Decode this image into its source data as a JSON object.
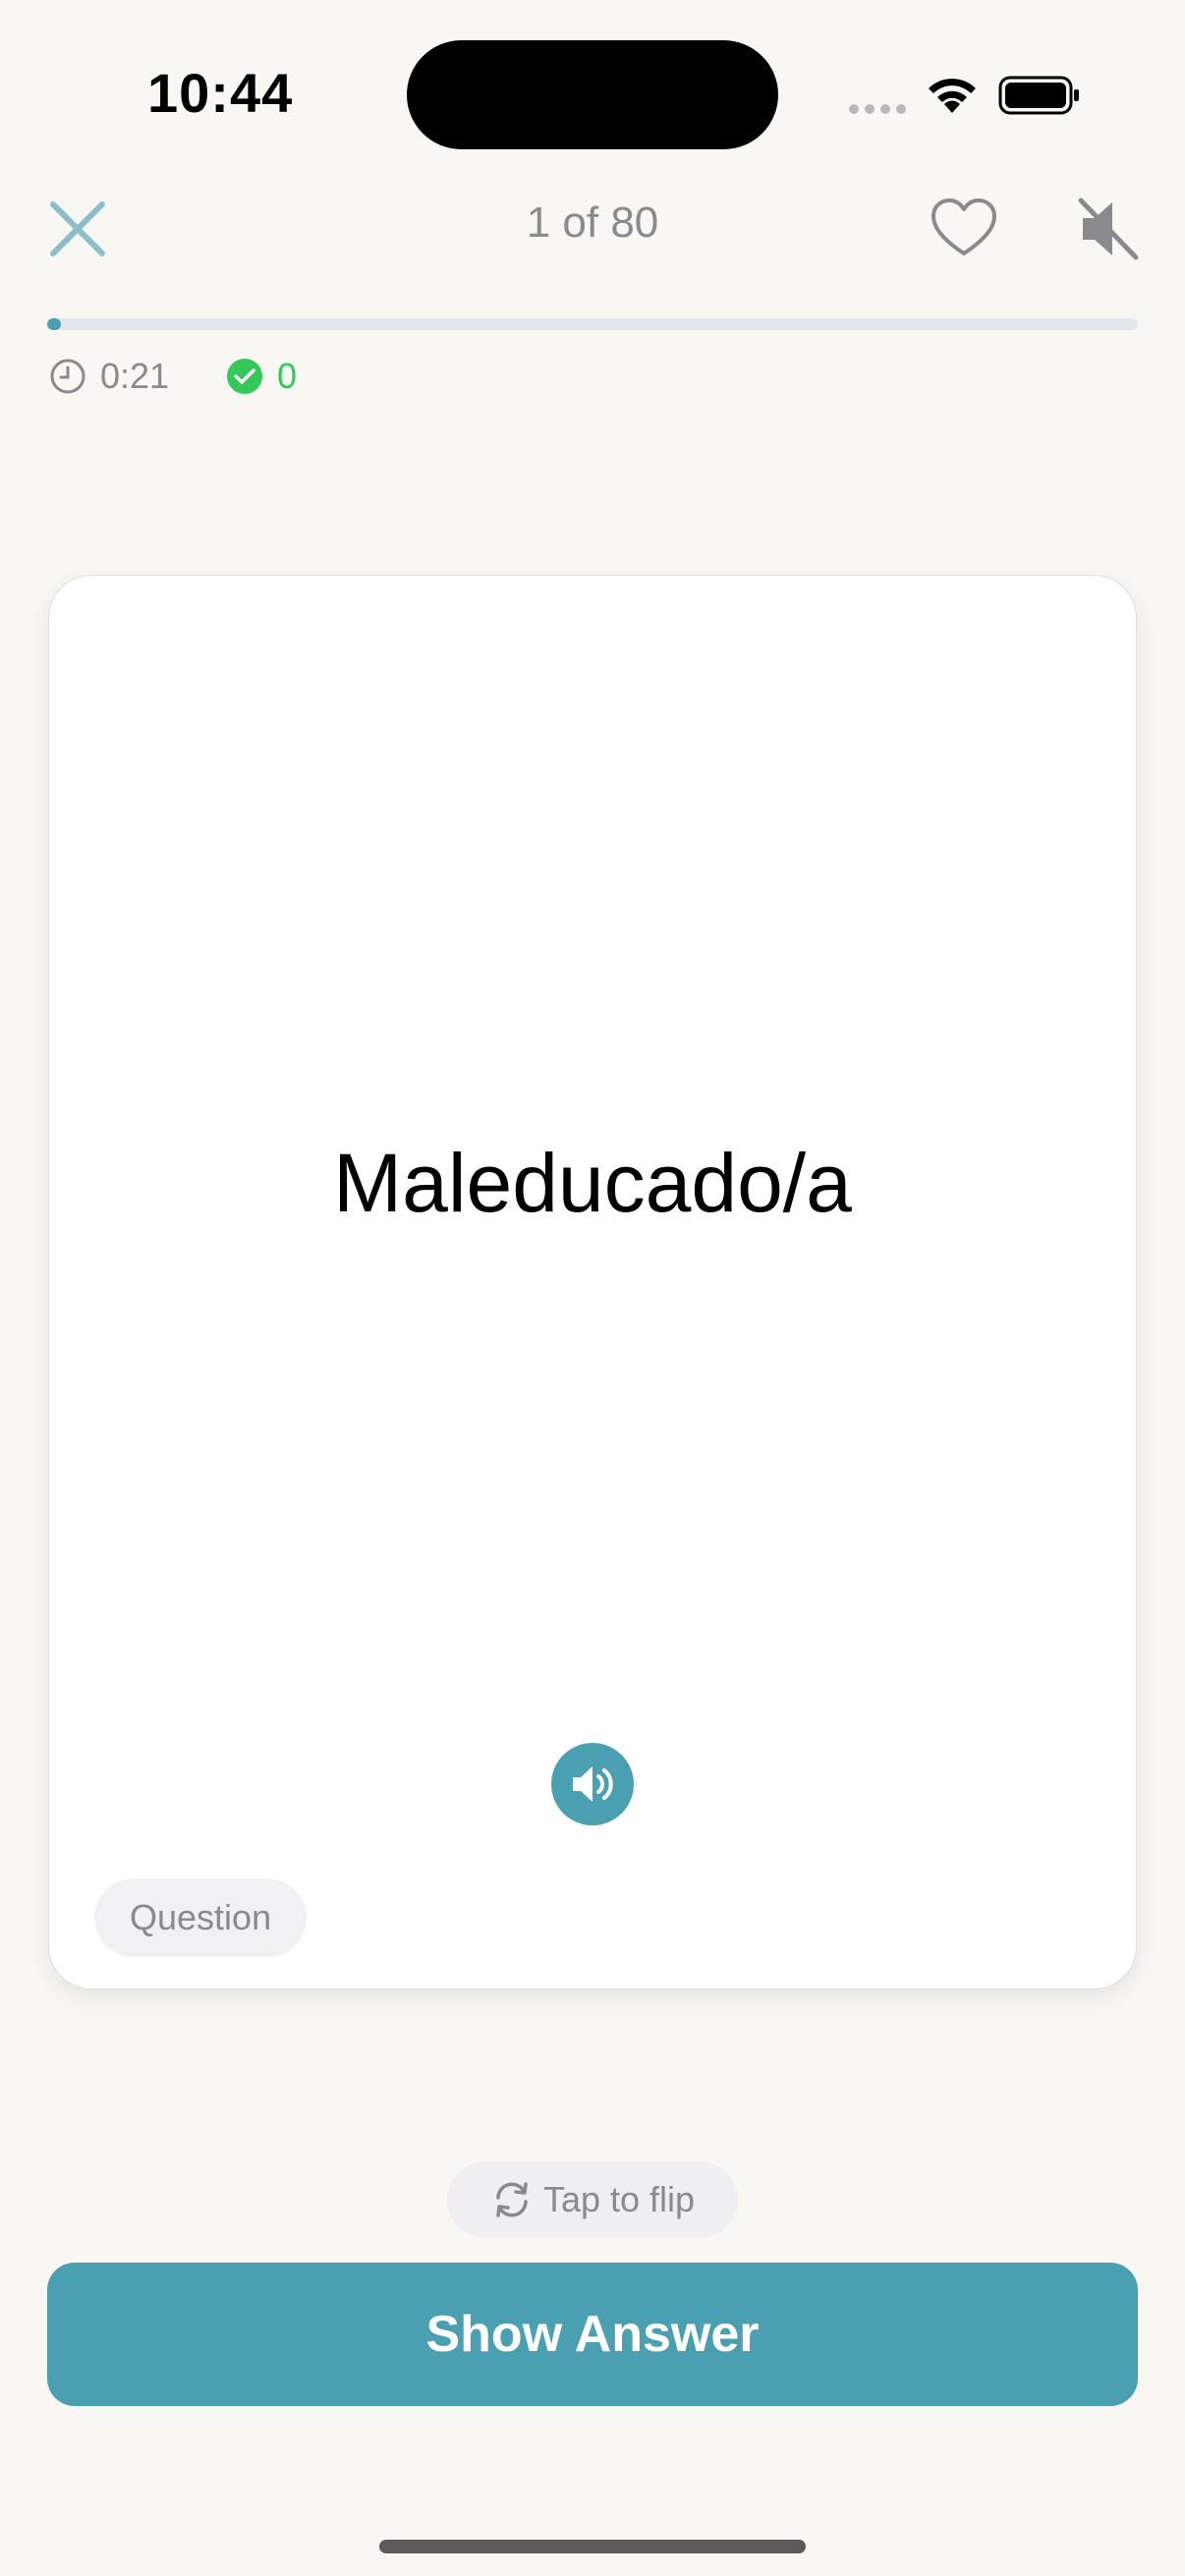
{
  "status_bar": {
    "time": "10:44",
    "icons": [
      "signal-dots-icon",
      "wifi-icon",
      "battery-icon"
    ]
  },
  "header": {
    "counter": "1 of 80",
    "icons": [
      "close-icon",
      "heart-icon",
      "speaker-muted-icon"
    ],
    "progress_fraction": 0.0125
  },
  "stats": {
    "timer": "0:21",
    "correct": "0",
    "icons": [
      "clock-icon",
      "check-circle-icon"
    ]
  },
  "card": {
    "term": "Maleducado/a",
    "side_label": "Question",
    "audio_icon": "speaker-icon"
  },
  "actions": {
    "flip_label": "Tap to flip",
    "flip_icon": "refresh-icon",
    "show_answer_label": "Show Answer"
  },
  "colors": {
    "accent": "#4a9fb0",
    "background": "#f8f7f4",
    "correct": "#34c759",
    "muted_text": "#8a8a8e"
  }
}
